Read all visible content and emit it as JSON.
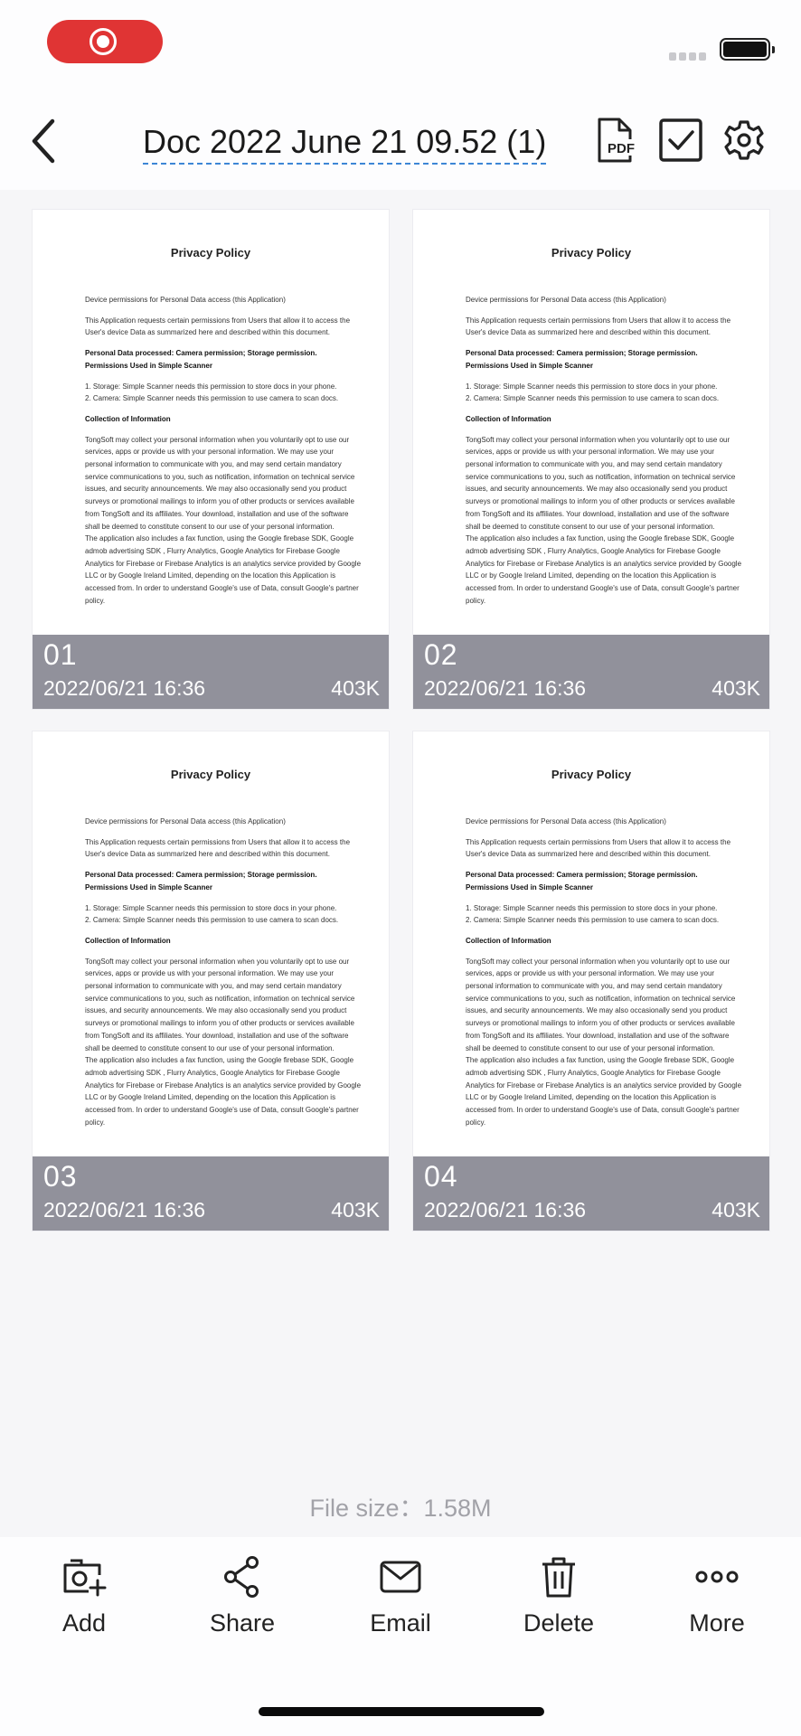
{
  "header": {
    "title": "Doc 2022 June 21 09.52 (1)",
    "pdf_icon_text": "PDF"
  },
  "pages": [
    {
      "number": "01",
      "date": "2022/06/21 16:36",
      "size": "403K"
    },
    {
      "number": "02",
      "date": "2022/06/21 16:36",
      "size": "403K"
    },
    {
      "number": "03",
      "date": "2022/06/21 16:36",
      "size": "403K"
    },
    {
      "number": "04",
      "date": "2022/06/21 16:36",
      "size": "403K"
    }
  ],
  "document_preview": {
    "title": "Privacy Policy",
    "lines": [
      {
        "t": "Device permissions for Personal Data access (this Application)",
        "bold": false
      },
      {
        "t": "",
        "gap": true
      },
      {
        "t": "This Application requests certain permissions from Users that allow it to access the",
        "bold": false
      },
      {
        "t": "User's device Data as summarized here and described within this document.",
        "bold": false
      },
      {
        "t": "",
        "gap": true
      },
      {
        "t": "Personal Data processed: Camera permission; Storage permission.",
        "bold": true
      },
      {
        "t": "Permissions Used in Simple Scanner",
        "bold": true
      },
      {
        "t": "",
        "gap": true
      },
      {
        "t": "1. Storage: Simple Scanner needs this permission to store docs in your phone.",
        "bold": false
      },
      {
        "t": "2. Camera: Simple Scanner needs this permission to use camera to scan docs.",
        "bold": false
      },
      {
        "t": "",
        "gap": true
      },
      {
        "t": "Collection of Information",
        "bold": true
      },
      {
        "t": "",
        "gap": true
      },
      {
        "t": "TongSoft may collect your personal information when you voluntarily opt to use our",
        "bold": false
      },
      {
        "t": "services, apps or provide us with your personal information. We may use your",
        "bold": false
      },
      {
        "t": "personal information to communicate with you, and may send certain mandatory",
        "bold": false
      },
      {
        "t": "service communications to you, such as notification, information on technical service",
        "bold": false
      },
      {
        "t": "issues, and security announcements. We may also occasionally send you product",
        "bold": false
      },
      {
        "t": "surveys or promotional mailings to inform you of other products or services available",
        "bold": false
      },
      {
        "t": "from TongSoft and its affiliates. Your download, installation and use of the software",
        "bold": false
      },
      {
        "t": "shall be deemed to constitute consent to our use of your personal information.",
        "bold": false
      },
      {
        "t": "The application also includes a fax function, using the Google firebase SDK, Google",
        "bold": false
      },
      {
        "t": "admob advertising SDK , Flurry Analytics, Google Analytics for Firebase Google",
        "bold": false
      },
      {
        "t": "Analytics for Firebase or Firebase Analytics is an analytics service provided by Google",
        "bold": false
      },
      {
        "t": "LLC or by Google Ireland Limited, depending on the location this Application is",
        "bold": false
      },
      {
        "t": "accessed from. In order to understand Google's use of Data, consult Google's partner",
        "bold": false
      },
      {
        "t": "policy.",
        "bold": false
      }
    ]
  },
  "footer": {
    "file_size": "File size：1.58M"
  },
  "toolbar": {
    "add": "Add",
    "share": "Share",
    "email": "Email",
    "delete": "Delete",
    "more": "More"
  },
  "colors": {
    "record_pill": "#e03434",
    "title_underline": "#3d86d6",
    "overlay": "#888892"
  }
}
